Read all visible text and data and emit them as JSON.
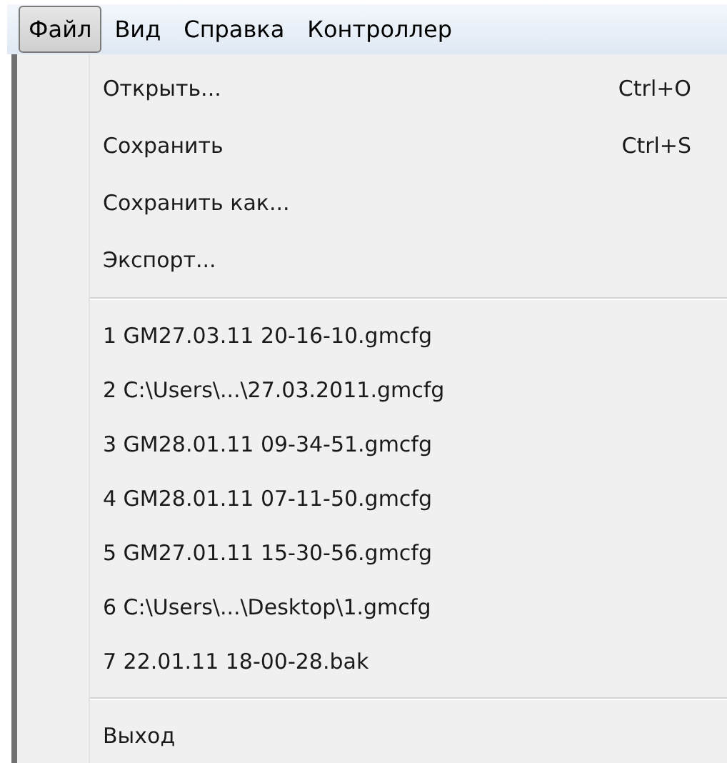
{
  "menu_bar": [
    {
      "label": "Файл",
      "selected": true
    },
    {
      "label": "Вид",
      "selected": false
    },
    {
      "label": "Справка",
      "selected": false
    },
    {
      "label": "Контроллер",
      "selected": false
    }
  ],
  "menu": {
    "groups": [
      [
        {
          "label": "Открыть...",
          "shortcut": "Ctrl+O"
        },
        {
          "label": "Сохранить",
          "shortcut": "Ctrl+S"
        },
        {
          "label": "Сохранить как..."
        },
        {
          "label": "Экспорт..."
        }
      ],
      [
        {
          "label": "1 GM27.03.11 20-16-10.gmcfg"
        },
        {
          "label": "2 C:\\Users\\...\\27.03.2011.gmcfg"
        },
        {
          "label": "3 GM28.01.11 09-34-51.gmcfg"
        },
        {
          "label": "4 GM28.01.11 07-11-50.gmcfg"
        },
        {
          "label": "5 GM27.01.11 15-30-56.gmcfg"
        },
        {
          "label": "6 C:\\Users\\...\\Desktop\\1.gmcfg"
        },
        {
          "label": "7 22.01.11 18-00-28.bak"
        }
      ],
      [
        {
          "label": "Выход"
        }
      ]
    ]
  }
}
